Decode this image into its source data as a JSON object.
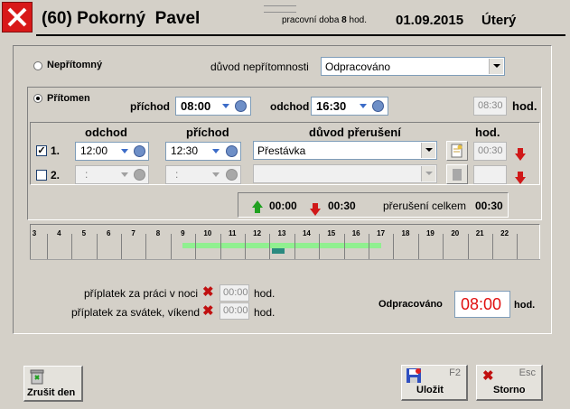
{
  "header": {
    "title": "(60) Pokorný  Pavel",
    "workday_label": "pracovní doba",
    "workday_hours": "8",
    "workday_unit": "hod.",
    "date": "01.09.2015",
    "weekday": "Úterý"
  },
  "absent": {
    "label": "Nepřítomný",
    "reason_label": "důvod nepřítomnosti",
    "reason_value": "Odpracováno"
  },
  "present": {
    "label": "Přítomen",
    "arrival_label": "příchod",
    "arrival_value": "08:00",
    "departure_label": "odchod",
    "departure_value": "16:30",
    "hours_value": "08:30",
    "hours_unit": "hod."
  },
  "breaks": {
    "columns": {
      "departure": "odchod",
      "arrival": "příchod",
      "reason": "důvod přerušení",
      "hours": "hod."
    },
    "rows": [
      {
        "index": "1.",
        "checked": true,
        "departure": "12:00",
        "arrival": "12:30",
        "reason": "Přestávka",
        "hours": "00:30"
      },
      {
        "index": "2.",
        "checked": false,
        "departure": ":",
        "arrival": ":",
        "reason": "",
        "hours": ""
      }
    ],
    "summary": {
      "up_value": "00:00",
      "down_value": "00:30",
      "total_label": "přerušení celkem",
      "total_value": "00:30"
    }
  },
  "timeline": {
    "hours": [
      "3",
      "4",
      "5",
      "6",
      "7",
      "8",
      "9",
      "10",
      "11",
      "12",
      "13",
      "14",
      "15",
      "16",
      "17",
      "18",
      "19",
      "20",
      "21",
      "22"
    ],
    "work_range": [
      9,
      17
    ],
    "break_range": [
      12.6,
      13.1
    ]
  },
  "surcharges": {
    "night_label": "příplatek za práci v noci",
    "night_value": "00:00",
    "holiday_label": "příplatek za svátek, víkend",
    "holiday_value": "00:00",
    "unit": "hod."
  },
  "worked": {
    "label": "Odpracováno",
    "value": "08:00",
    "unit": "hod."
  },
  "buttons": {
    "cancel_day": "Zrušit den",
    "save": "Uložit",
    "save_key": "F2",
    "cancel": "Storno",
    "cancel_key": "Esc"
  },
  "colors": {
    "worked_value": "#e01010",
    "timeline_work": "#90f090",
    "timeline_break": "#2a8a80"
  }
}
